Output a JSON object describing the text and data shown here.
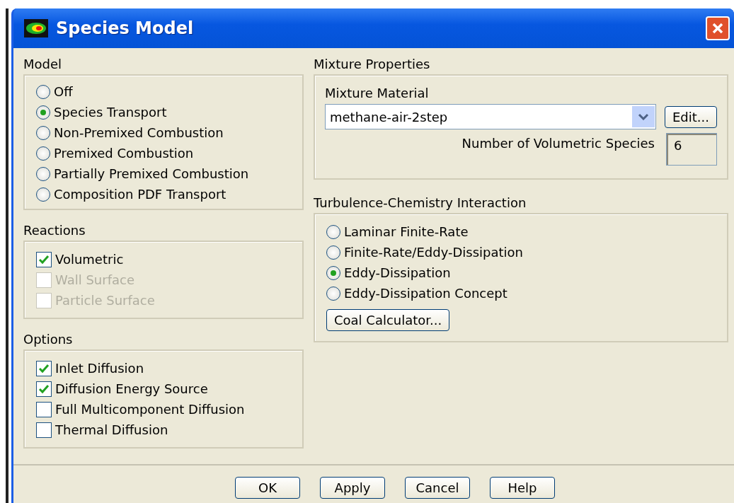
{
  "window": {
    "title": "Species Model"
  },
  "model": {
    "label": "Model",
    "options": [
      {
        "label": "Off",
        "selected": false
      },
      {
        "label": "Species Transport",
        "selected": true
      },
      {
        "label": "Non-Premixed Combustion",
        "selected": false
      },
      {
        "label": "Premixed Combustion",
        "selected": false
      },
      {
        "label": "Partially Premixed Combustion",
        "selected": false
      },
      {
        "label": "Composition PDF Transport",
        "selected": false
      }
    ]
  },
  "reactions": {
    "label": "Reactions",
    "options": [
      {
        "label": "Volumetric",
        "checked": true,
        "disabled": false
      },
      {
        "label": "Wall Surface",
        "checked": false,
        "disabled": true
      },
      {
        "label": "Particle Surface",
        "checked": false,
        "disabled": true
      }
    ]
  },
  "options": {
    "label": "Options",
    "options": [
      {
        "label": "Inlet Diffusion",
        "checked": true,
        "disabled": false
      },
      {
        "label": "Diffusion Energy Source",
        "checked": true,
        "disabled": false
      },
      {
        "label": "Full Multicomponent Diffusion",
        "checked": false,
        "disabled": false
      },
      {
        "label": "Thermal Diffusion",
        "checked": false,
        "disabled": false
      }
    ]
  },
  "mixture_properties": {
    "label": "Mixture Properties",
    "material_label": "Mixture Material",
    "material": "methane-air-2step",
    "edit_button": "Edit...",
    "species_label": "Number of Volumetric Species",
    "species_count": "6"
  },
  "turbulence_chemistry": {
    "label": "Turbulence-Chemistry Interaction",
    "options": [
      {
        "label": "Laminar Finite-Rate",
        "selected": false
      },
      {
        "label": "Finite-Rate/Eddy-Dissipation",
        "selected": false
      },
      {
        "label": "Eddy-Dissipation",
        "selected": true
      },
      {
        "label": "Eddy-Dissipation Concept",
        "selected": false
      }
    ],
    "button": "Coal Calculator..."
  },
  "buttons": [
    "OK",
    "Apply",
    "Cancel",
    "Help"
  ]
}
